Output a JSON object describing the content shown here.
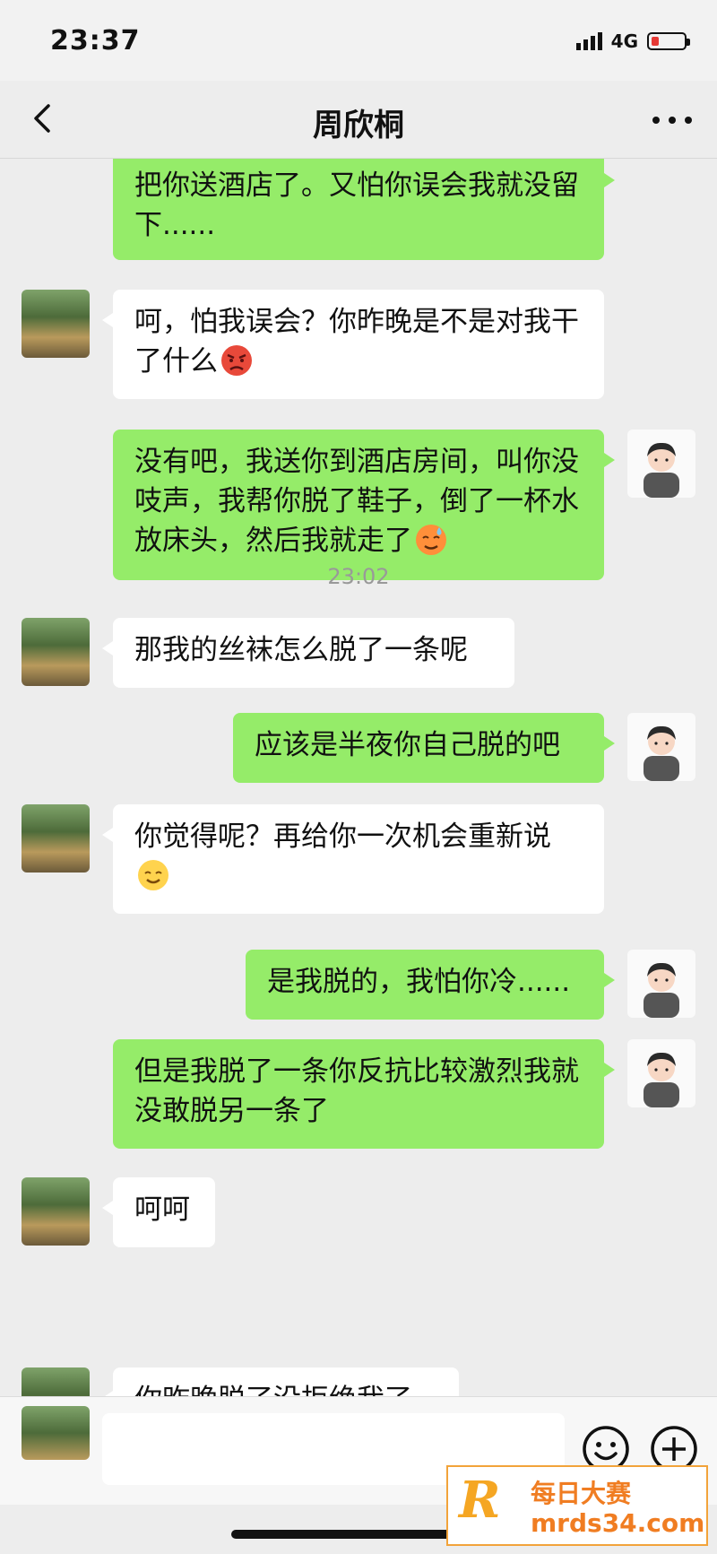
{
  "status_bar": {
    "time": "23:37",
    "network": "4G"
  },
  "header": {
    "title": "周欣桐"
  },
  "messages": [
    {
      "side": "out",
      "text": "把你送酒店了。又怕你误会我就没留下......"
    },
    {
      "side": "in",
      "text": "呵，怕我误会？你昨晚是不是对我干了什么",
      "emoji": "angry-emoji"
    },
    {
      "side": "out",
      "text": "没有吧，我送你到酒店房间，叫你没吱声，我帮你脱了鞋子，倒了一杯水放床头，然后我就走了",
      "emoji": "sweat-emoji"
    },
    {
      "side": "time",
      "text": "23:02"
    },
    {
      "side": "in",
      "text": "那我的丝袜怎么脱了一条呢"
    },
    {
      "side": "out",
      "text": "应该是半夜你自己脱的吧"
    },
    {
      "side": "in",
      "text": "你觉得呢？再给你一次机会重新说",
      "emoji": "smile-emoji"
    },
    {
      "side": "out",
      "text": "是我脱的，我怕你冷......"
    },
    {
      "side": "out",
      "text": "但是我脱了一条你反抗比较激烈我就没敢脱另一条了"
    },
    {
      "side": "in",
      "text": "呵呵"
    },
    {
      "side": "in",
      "text": "你昨晚脱了没拒绝我了"
    }
  ],
  "watermark": {
    "logo": "R",
    "name": "每日大赛",
    "url": "mrds34.com"
  }
}
